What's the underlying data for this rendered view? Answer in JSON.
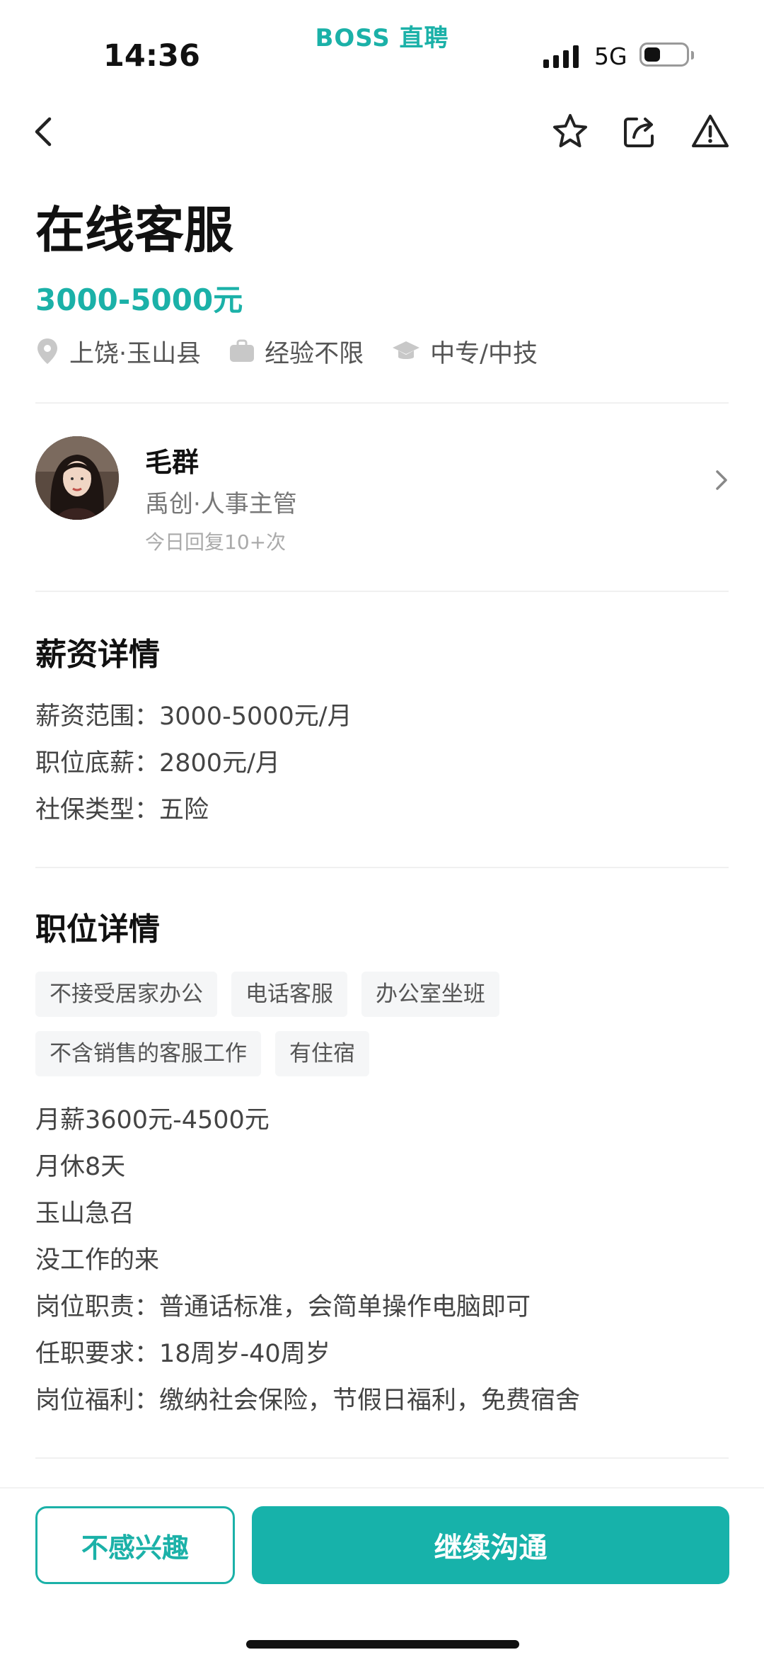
{
  "status_bar": {
    "brand": "BOSS 直聘",
    "time": "14:36",
    "network": "5G"
  },
  "nav": {
    "back_icon": "chevron-left-icon",
    "favorite_icon": "star-icon",
    "share_icon": "share-icon",
    "report_icon": "warning-icon"
  },
  "job": {
    "title": "在线客服",
    "salary": "3000-5000元",
    "location": "上饶·玉山县",
    "experience": "经验不限",
    "education": "中专/中技"
  },
  "recruiter": {
    "name": "毛群",
    "role": "禹创·人事主管",
    "reply_stat": "今日回复10+次"
  },
  "salary_details": {
    "title": "薪资详情",
    "lines": [
      "薪资范围：3000-5000元/月",
      "职位底薪：2800元/月",
      "社保类型：五险"
    ]
  },
  "job_details": {
    "title": "职位详情",
    "tags_row1": [
      "不接受居家办公",
      "电话客服",
      "办公室坐班"
    ],
    "tags_row2": [
      "不含销售的客服工作",
      "有住宿"
    ],
    "description": [
      "月薪3600元-4500元",
      "月休8天",
      "玉山急召",
      "没工作的来",
      "岗位职责：普通话标准，会简单操作电脑即可",
      "任职要求：18周岁-40周岁",
      "岗位福利：缴纳社会保险，节假日福利，免费宿舍"
    ]
  },
  "actions": {
    "not_interested": "不感兴趣",
    "continue_chat": "继续沟通"
  },
  "colors": {
    "accent": "#1bb1a8"
  }
}
